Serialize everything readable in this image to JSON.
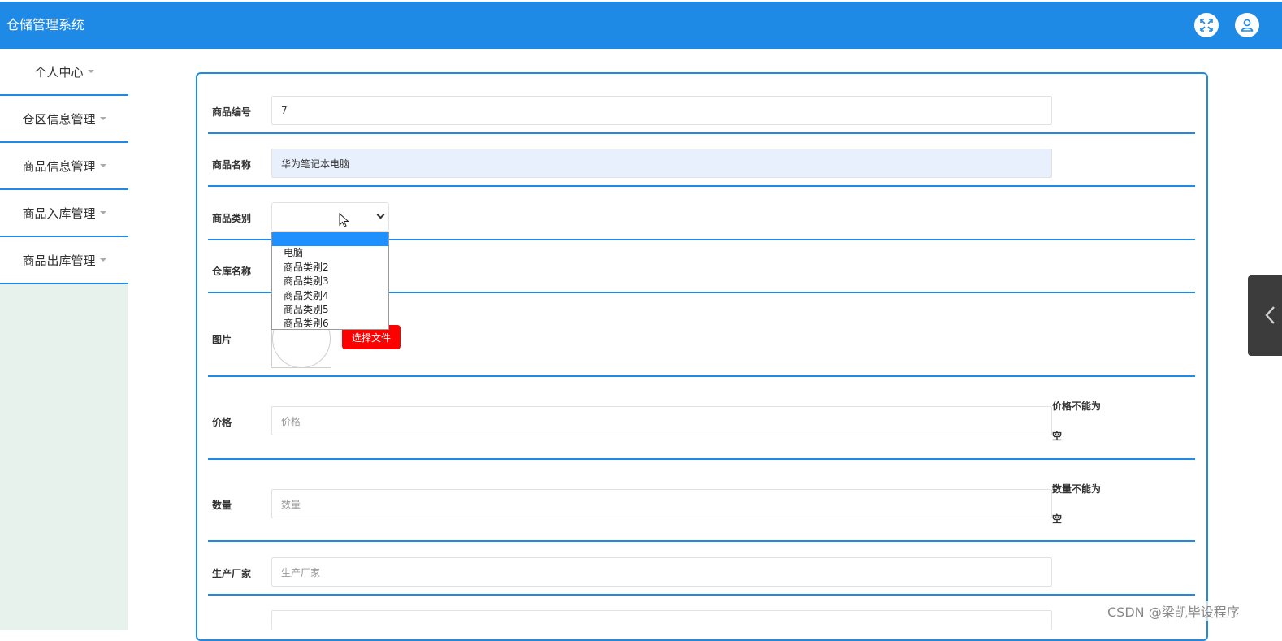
{
  "header": {
    "title": "仓储管理系统",
    "icons": [
      "fullscreen-icon",
      "user-icon"
    ]
  },
  "sidebar": {
    "items": [
      {
        "label": "个人中心"
      },
      {
        "label": "仓区信息管理"
      },
      {
        "label": "商品信息管理"
      },
      {
        "label": "商品入库管理"
      },
      {
        "label": "商品出库管理"
      }
    ]
  },
  "form": {
    "product_code": {
      "label": "商品编号",
      "value": "7"
    },
    "product_name": {
      "label": "商品名称",
      "value": "华为笔记本电脑"
    },
    "product_category": {
      "label": "商品类别",
      "value": "",
      "options": [
        "",
        "电脑",
        "商品类别2",
        "商品类别3",
        "商品类别4",
        "商品类别5",
        "商品类别6"
      ]
    },
    "warehouse_name": {
      "label": "仓库名称"
    },
    "image": {
      "label": "图片",
      "button_label": "选择文件"
    },
    "price": {
      "label": "价格",
      "placeholder": "价格",
      "error_line1": "价格不能为",
      "error_line2": "空"
    },
    "quantity": {
      "label": "数量",
      "placeholder": "数量",
      "error_line1": "数量不能为",
      "error_line2": "空"
    },
    "manufacturer": {
      "label": "生产厂家",
      "placeholder": "生产厂家"
    }
  },
  "watermark": "CSDN @梁凯毕设程序",
  "colors": {
    "primary": "#1f8ae6",
    "button_red": "#ff0000",
    "dropdown_selected": "#1e90ff"
  }
}
